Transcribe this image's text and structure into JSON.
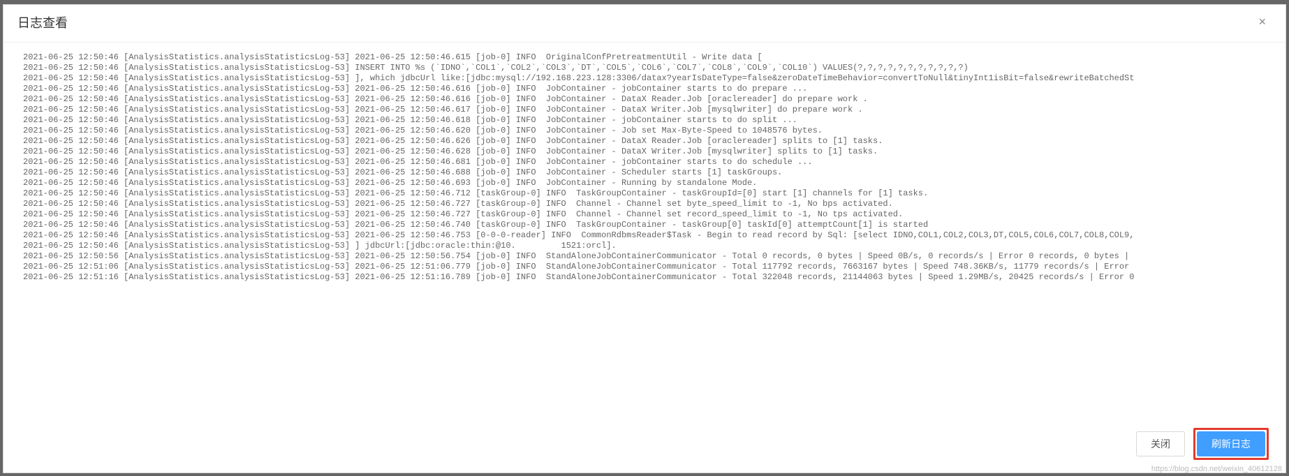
{
  "modal": {
    "title": "日志查看",
    "close_symbol": "×"
  },
  "footer": {
    "close_label": "关闭",
    "refresh_label": "刷新日志"
  },
  "watermark": "https://blog.csdn.net/weixin_40612128",
  "log_lines": [
    "2021-06-25 12:50:46 [AnalysisStatistics.analysisStatisticsLog-53] 2021-06-25 12:50:46.615 [job-0] INFO  OriginalConfPretreatmentUtil - Write data [",
    "2021-06-25 12:50:46 [AnalysisStatistics.analysisStatisticsLog-53] INSERT INTO %s (`IDNO`,`COL1`,`COL2`,`COL3`,`DT`,`COL5`,`COL6`,`COL7`,`COL8`,`COL9`,`COL10`) VALUES(?,?,?,?,?,?,?,?,?,?,?)",
    "2021-06-25 12:50:46 [AnalysisStatistics.analysisStatisticsLog-53] ], which jdbcUrl like:[jdbc:mysql://192.168.223.128:3306/datax?yearIsDateType=false&zeroDateTimeBehavior=convertToNull&tinyInt1isBit=false&rewriteBatchedSt",
    "2021-06-25 12:50:46 [AnalysisStatistics.analysisStatisticsLog-53] 2021-06-25 12:50:46.616 [job-0] INFO  JobContainer - jobContainer starts to do prepare ...",
    "2021-06-25 12:50:46 [AnalysisStatistics.analysisStatisticsLog-53] 2021-06-25 12:50:46.616 [job-0] INFO  JobContainer - DataX Reader.Job [oraclereader] do prepare work .",
    "2021-06-25 12:50:46 [AnalysisStatistics.analysisStatisticsLog-53] 2021-06-25 12:50:46.617 [job-0] INFO  JobContainer - DataX Writer.Job [mysqlwriter] do prepare work .",
    "2021-06-25 12:50:46 [AnalysisStatistics.analysisStatisticsLog-53] 2021-06-25 12:50:46.618 [job-0] INFO  JobContainer - jobContainer starts to do split ...",
    "2021-06-25 12:50:46 [AnalysisStatistics.analysisStatisticsLog-53] 2021-06-25 12:50:46.620 [job-0] INFO  JobContainer - Job set Max-Byte-Speed to 1048576 bytes.",
    "2021-06-25 12:50:46 [AnalysisStatistics.analysisStatisticsLog-53] 2021-06-25 12:50:46.626 [job-0] INFO  JobContainer - DataX Reader.Job [oraclereader] splits to [1] tasks.",
    "2021-06-25 12:50:46 [AnalysisStatistics.analysisStatisticsLog-53] 2021-06-25 12:50:46.628 [job-0] INFO  JobContainer - DataX Writer.Job [mysqlwriter] splits to [1] tasks.",
    "2021-06-25 12:50:46 [AnalysisStatistics.analysisStatisticsLog-53] 2021-06-25 12:50:46.681 [job-0] INFO  JobContainer - jobContainer starts to do schedule ...",
    "2021-06-25 12:50:46 [AnalysisStatistics.analysisStatisticsLog-53] 2021-06-25 12:50:46.688 [job-0] INFO  JobContainer - Scheduler starts [1] taskGroups.",
    "2021-06-25 12:50:46 [AnalysisStatistics.analysisStatisticsLog-53] 2021-06-25 12:50:46.693 [job-0] INFO  JobContainer - Running by standalone Mode.",
    "2021-06-25 12:50:46 [AnalysisStatistics.analysisStatisticsLog-53] 2021-06-25 12:50:46.712 [taskGroup-0] INFO  TaskGroupContainer - taskGroupId=[0] start [1] channels for [1] tasks.",
    "2021-06-25 12:50:46 [AnalysisStatistics.analysisStatisticsLog-53] 2021-06-25 12:50:46.727 [taskGroup-0] INFO  Channel - Channel set byte_speed_limit to -1, No bps activated.",
    "2021-06-25 12:50:46 [AnalysisStatistics.analysisStatisticsLog-53] 2021-06-25 12:50:46.727 [taskGroup-0] INFO  Channel - Channel set record_speed_limit to -1, No tps activated.",
    "2021-06-25 12:50:46 [AnalysisStatistics.analysisStatisticsLog-53] 2021-06-25 12:50:46.740 [taskGroup-0] INFO  TaskGroupContainer - taskGroup[0] taskId[0] attemptCount[1] is started",
    "2021-06-25 12:50:46 [AnalysisStatistics.analysisStatisticsLog-53] 2021-06-25 12:50:46.753 [0-0-0-reader] INFO  CommonRdbmsReader$Task - Begin to read record by Sql: [select IDNO,COL1,COL2,COL3,DT,COL5,COL6,COL7,COL8,COL9,",
    "2021-06-25 12:50:46 [AnalysisStatistics.analysisStatisticsLog-53] ] jdbcUrl:[jdbc:oracle:thin:@10.         1521:orcl].",
    "2021-06-25 12:50:56 [AnalysisStatistics.analysisStatisticsLog-53] 2021-06-25 12:50:56.754 [job-0] INFO  StandAloneJobContainerCommunicator - Total 0 records, 0 bytes | Speed 0B/s, 0 records/s | Error 0 records, 0 bytes |",
    "2021-06-25 12:51:06 [AnalysisStatistics.analysisStatisticsLog-53] 2021-06-25 12:51:06.779 [job-0] INFO  StandAloneJobContainerCommunicator - Total 117792 records, 7663167 bytes | Speed 748.36KB/s, 11779 records/s | Error",
    "2021-06-25 12:51:16 [AnalysisStatistics.analysisStatisticsLog-53] 2021-06-25 12:51:16.789 [job-0] INFO  StandAloneJobContainerCommunicator - Total 322048 records, 21144063 bytes | Speed 1.29MB/s, 20425 records/s | Error 0"
  ]
}
